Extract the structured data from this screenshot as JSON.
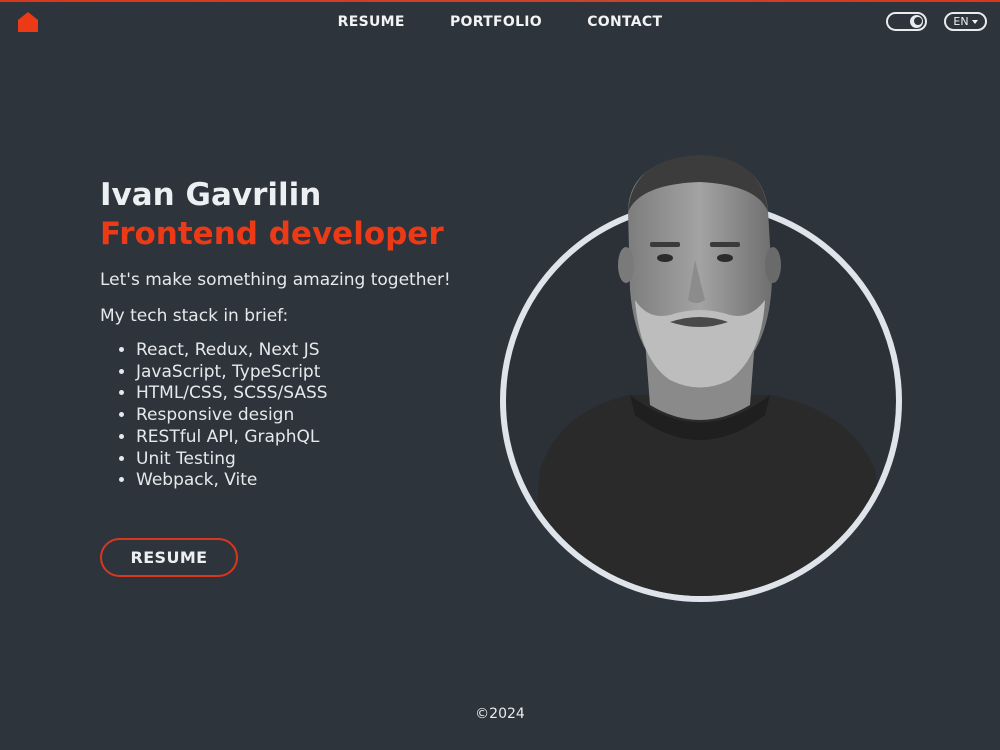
{
  "colors": {
    "background": "#2d343b",
    "accent": "#ec3a16",
    "text": "#e9ecef"
  },
  "header": {
    "home_icon": "home-icon",
    "nav": [
      "RESUME",
      "PORTFOLIO",
      "CONTACT"
    ],
    "theme_toggle_icon": "moon-icon",
    "language": "EN"
  },
  "hero": {
    "name": "Ivan Gavrilin",
    "role": "Frontend developer",
    "tagline": "Let's make something amazing together!",
    "stack_title": "My tech stack in brief:",
    "stack": [
      "React, Redux, Next JS",
      "JavaScript, TypeScript",
      "HTML/CSS, SCSS/SASS",
      "Responsive design",
      "RESTful API, GraphQL",
      "Unit Testing",
      "Webpack, Vite"
    ],
    "cta": "RESUME"
  },
  "footer": {
    "copyright": "©2024"
  }
}
